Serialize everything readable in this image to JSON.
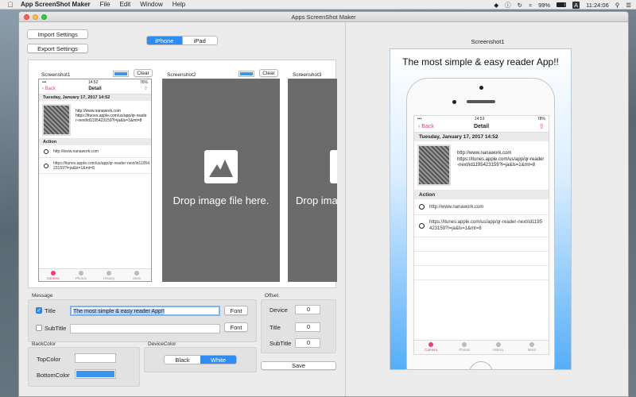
{
  "menubar": {
    "app_name": "App ScreenShot Maker",
    "items": [
      "File",
      "Edit",
      "Window",
      "Help"
    ],
    "battery": "99%",
    "input_source": "A",
    "clock": "11:24:06"
  },
  "window": {
    "title": "Apps ScreenShot Maker"
  },
  "toolbar": {
    "import_label": "Import Settings",
    "export_label": "Export Settings",
    "device_segments": [
      "iPhone",
      "iPad"
    ],
    "device_selected": "iPhone"
  },
  "canvas": {
    "clear_label": "Clear",
    "slots": [
      {
        "title": "Screenshot1"
      },
      {
        "title": "Screenshot2",
        "drop_text": "Drop image file here."
      },
      {
        "title": "Screenshot3",
        "drop_text": "Drop ima"
      }
    ],
    "accent_color": "#3b95ec"
  },
  "mini_app": {
    "time": "14:52",
    "battery": "76%",
    "back": "Back",
    "title": "Detail",
    "date": "Tuesday, January 17, 2017 14:52",
    "qr_text": "http://www.nanawork.com\nhttps://itunes.apple.com/us/app/qr-reader-next/id1195423159?l=ja&ls=1&mt=8",
    "action_header": "Action",
    "link1": "http://www.nanawork.com",
    "link2": "https://itunes.apple.com/us/app/qr-reader-next/id1195423159?l=ja&ls=1&mt=8",
    "tabs": [
      "Camera",
      "Photos",
      "History",
      "More"
    ]
  },
  "preview_app": {
    "time": "14:53",
    "battery": "78%",
    "back": "Back",
    "title": "Detail",
    "date": "Tuesday, January 17, 2017 14:52",
    "qr_text": "http://www.nanawork.com\nhttps://itunes.apple.com/us/app/qr-reader-next/id1195423159?l=ja&ls=1&mt=8",
    "action_header": "Action",
    "link1": "http://www.nanawork.com",
    "link2": "https://itunes.apple.com/us/app/qr-reader-next/id1195423159?l=ja&ls=1&mt=8",
    "tabs": [
      "Camera",
      "Photos",
      "History",
      "More"
    ]
  },
  "message": {
    "group_label": "Message",
    "title_label": "Title",
    "title_checked": true,
    "title_value": "The most simple & easy reader App!!",
    "subtitle_label": "SubTitle",
    "subtitle_checked": false,
    "subtitle_value": "",
    "font_label": "Font"
  },
  "offset": {
    "group_label": "Offset",
    "device_label": "Device",
    "device_value": "0",
    "title_label": "Title",
    "title_value": "0",
    "subtitle_label": "SubTitle",
    "subtitle_value": "0"
  },
  "backcolor": {
    "group_label": "BackColor",
    "top_label": "TopColor",
    "top_color": "#ffffff",
    "bottom_label": "BottomColor",
    "bottom_color": "#3b95ec"
  },
  "devicecolor": {
    "group_label": "DeviceColor",
    "options": [
      "Black",
      "White"
    ],
    "selected": "White"
  },
  "save_label": "Save",
  "preview": {
    "caption": "Screenshot1",
    "headline": "The most simple & easy reader App!!"
  }
}
